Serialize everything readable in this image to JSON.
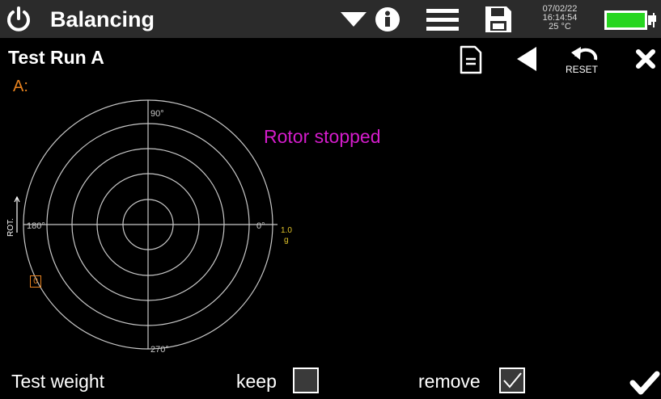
{
  "header": {
    "title": "Balancing",
    "date": "07/02/22",
    "time": "16:14:54",
    "temperature": "25 °C",
    "icons": [
      "power-icon",
      "dropdown-arrow-icon",
      "info-icon",
      "menu-icon",
      "save-icon",
      "battery-icon"
    ],
    "battery_color": "#27d620"
  },
  "subheader": {
    "title": "Test Run A",
    "reset_label": "RESET",
    "icons": [
      "document-icon",
      "back-arrow-icon",
      "reset-icon",
      "close-icon"
    ]
  },
  "plot": {
    "channel": "A:",
    "status": "Rotor stopped",
    "status_color": "#d41ccb",
    "angles": {
      "top": "90°",
      "left": "180°",
      "right": "0°",
      "bottom": "270°"
    },
    "scale_value": "1.0",
    "scale_unit": "g",
    "rotation_label": "ROT.",
    "marker_label": "0",
    "marker_color": "#e8821e",
    "rings": 5
  },
  "footer": {
    "test_weight_label": "Test weight",
    "keep_label": "keep",
    "keep_checked": false,
    "remove_label": "remove",
    "remove_checked": true
  }
}
